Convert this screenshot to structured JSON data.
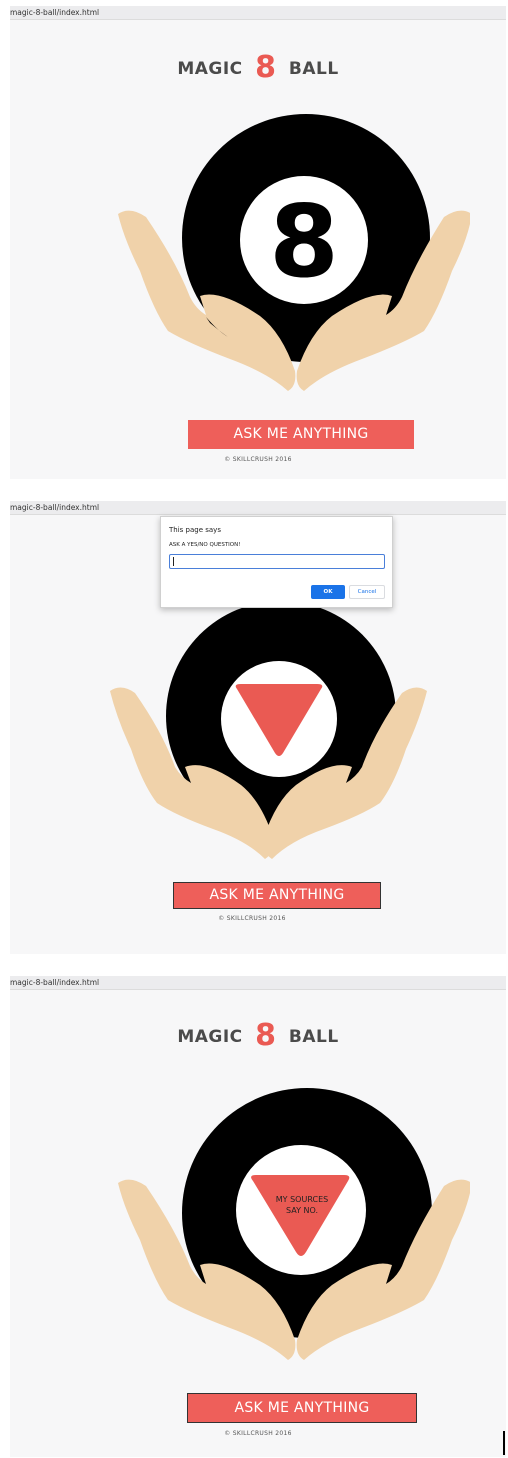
{
  "app": {
    "url": "magic-8-ball/index.html"
  },
  "title": {
    "pre": "MAGIC",
    "eight": "8",
    "post": "BALL"
  },
  "ball": {
    "number": "8"
  },
  "button": {
    "label": "ASK ME ANYTHING"
  },
  "footer": {
    "copyright": "© SKILLCRUSH 2016"
  },
  "dialog": {
    "title": "This page says",
    "message": "ASK A YES/NO QUESTION!",
    "input_value": "",
    "ok_label": "OK",
    "cancel_label": "Cancel"
  },
  "answer": {
    "line1": "MY SOURCES",
    "line2": "SAY NO."
  },
  "colors": {
    "accent": "#ee5f5a",
    "ball": "#000000",
    "hands": "#f0d2aa",
    "background": "#f7f7f8"
  }
}
